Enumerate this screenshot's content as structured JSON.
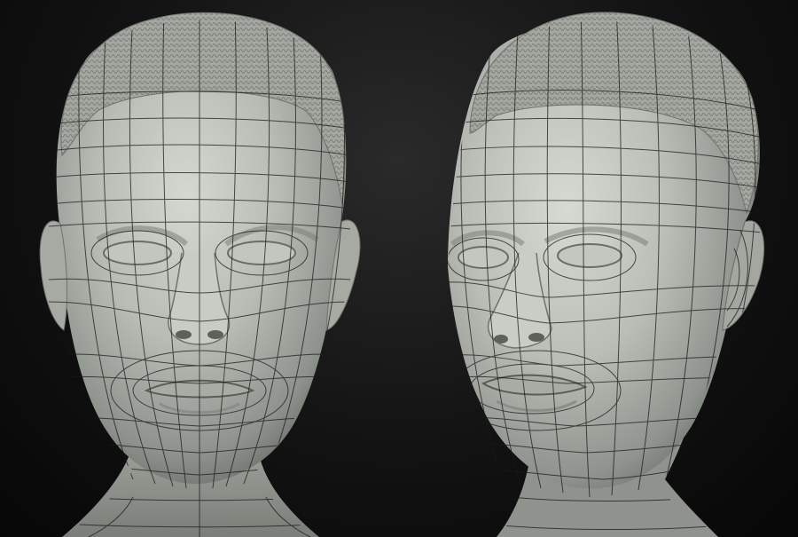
{
  "scene": {
    "background_color": "#0b0b0b",
    "material_color": "#b9bdb6",
    "wire_color": "#1a1a1a",
    "views": [
      {
        "name": "front-view"
      },
      {
        "name": "three-quarter-view"
      }
    ]
  }
}
